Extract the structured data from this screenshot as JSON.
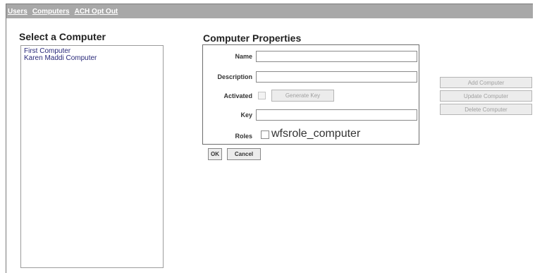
{
  "nav": {
    "links": [
      "Users",
      "Computers",
      "ACH Opt Out"
    ]
  },
  "select_computer": {
    "heading": "Select a Computer",
    "items": [
      "First Computer",
      "Karen Maddi Computer"
    ]
  },
  "properties": {
    "heading": "Computer Properties",
    "name_label": "Name",
    "name_value": "",
    "description_label": "Description",
    "description_value": "",
    "activated_label": "Activated",
    "activated_checked": false,
    "generate_key_label": "Generate Key",
    "key_label": "Key",
    "key_value": "",
    "roles_label": "Roles",
    "role_option": "wfsrole_computer",
    "role_checked": false
  },
  "form_buttons": {
    "ok_label": "OK",
    "cancel_label": "Cancel"
  },
  "actions": {
    "add_label": "Add Computer",
    "update_label": "Update Computer",
    "delete_label": "Delete Computer"
  }
}
